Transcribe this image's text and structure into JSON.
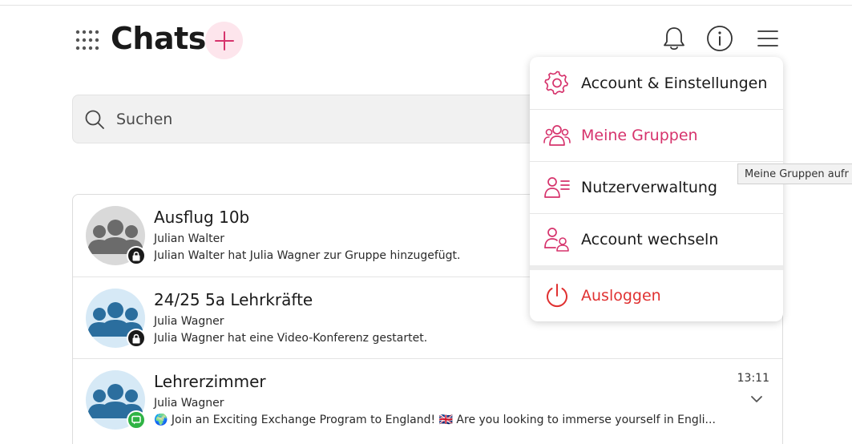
{
  "header": {
    "title": "Chats"
  },
  "search": {
    "placeholder": "Suchen"
  },
  "chats": [
    {
      "name": "Ausflug 10b",
      "sender": "Julian Walter",
      "message": "Julian Walter hat Julia Wagner zur Gruppe hinzugefügt.",
      "time": "",
      "avatar_color": "#6b6b6b",
      "avatar_bg": "#d9d9d9",
      "badge": "lock-icon"
    },
    {
      "name": "24/25 5a Lehrkräfte",
      "sender": "Julia Wagner",
      "message": "Julia Wagner hat eine Video-Konferenz gestartet.",
      "time": "",
      "avatar_color": "#2b6e9e",
      "avatar_bg": "#d6e9f6",
      "badge": "lock-icon"
    },
    {
      "name": "Lehrerzimmer",
      "sender": "Julia Wagner",
      "message": "🌍 Join an Exciting Exchange Program to England! 🇬🇧 Are you looking to immerse yourself in Engli...",
      "time": "13:11",
      "avatar_color": "#2b6e9e",
      "avatar_bg": "#d6e9f6",
      "badge": "chat-bubble-icon"
    }
  ],
  "menu": {
    "items": [
      {
        "label": "Account & Einstellungen",
        "icon": "gear-icon",
        "color": "#1a1a1a"
      },
      {
        "label": "Meine Gruppen",
        "icon": "group-icon",
        "color": "#d6336c"
      },
      {
        "label": "Nutzerverwaltung",
        "icon": "user-list-icon",
        "color": "#1a1a1a"
      },
      {
        "label": "Account wechseln",
        "icon": "switch-account-icon",
        "color": "#1a1a1a"
      },
      {
        "label": "Ausloggen",
        "icon": "power-icon",
        "color": "#e03131"
      }
    ]
  },
  "tooltip": {
    "text": "Meine Gruppen aufr"
  },
  "colors": {
    "accent": "#d6336c",
    "danger": "#e03131",
    "accent_bg": "#fde5ec",
    "badge_green": "#2fb344"
  }
}
